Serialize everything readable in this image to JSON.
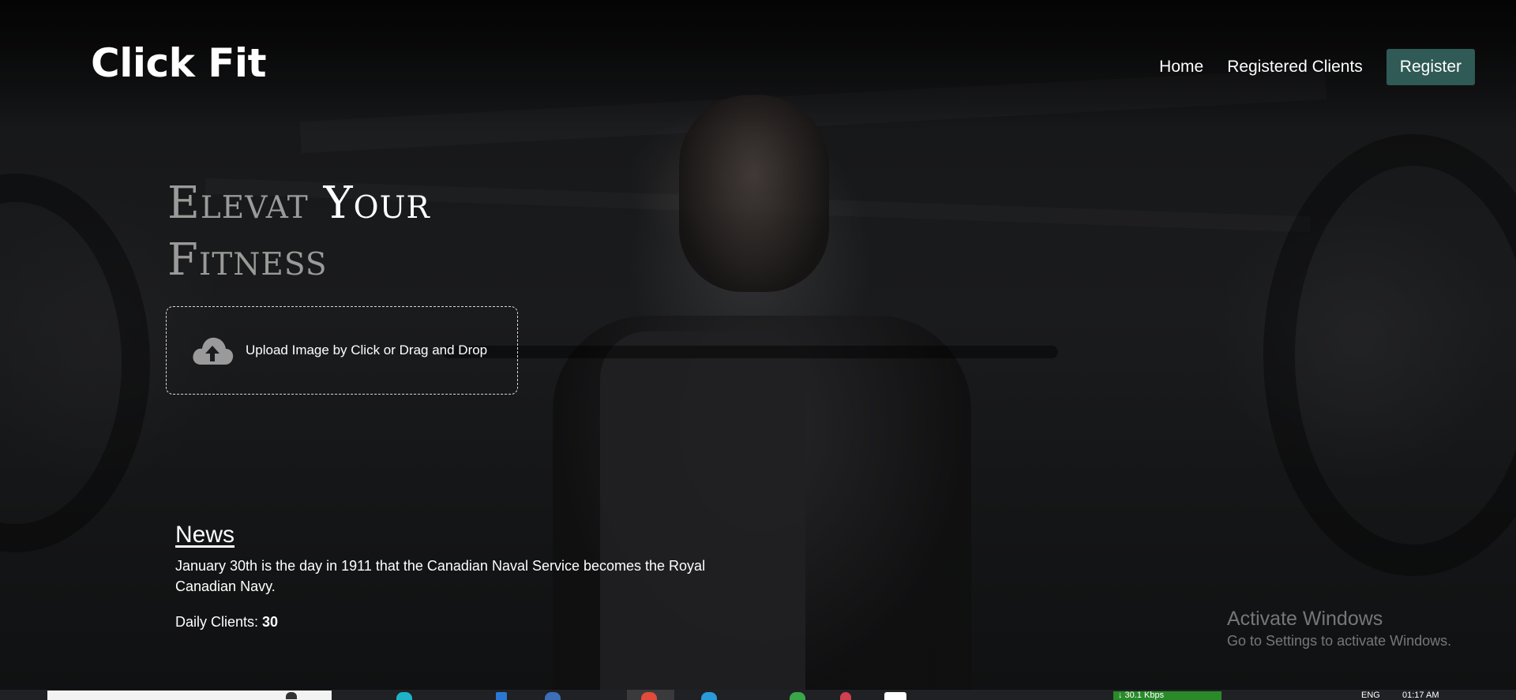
{
  "header": {
    "logo": "Click Fit",
    "nav": {
      "home": "Home",
      "clients": "Registered Clients",
      "register": "Register"
    }
  },
  "hero": {
    "word1": "Elevat",
    "word2": "Your",
    "word3": "Fitness"
  },
  "upload": {
    "icon": "cloud-upload-icon",
    "label": "Upload Image by Click or Drag and Drop"
  },
  "news": {
    "title": "News",
    "body": "January 30th is the day in 1911 that the Canadian Naval Service becomes the Royal Canadian Navy.",
    "daily_label": "Daily Clients:",
    "daily_count": "30"
  },
  "watermark": {
    "title": "Activate Windows",
    "subtitle": "Go to Settings to activate Windows."
  },
  "taskbar": {
    "network": "↓ 30.1 Kbps",
    "language": "ENG",
    "time": "01:17 AM"
  },
  "colors": {
    "register_button": "#2f5a55",
    "background": "#0f0f10",
    "hero_muted": "#9a9a98"
  }
}
